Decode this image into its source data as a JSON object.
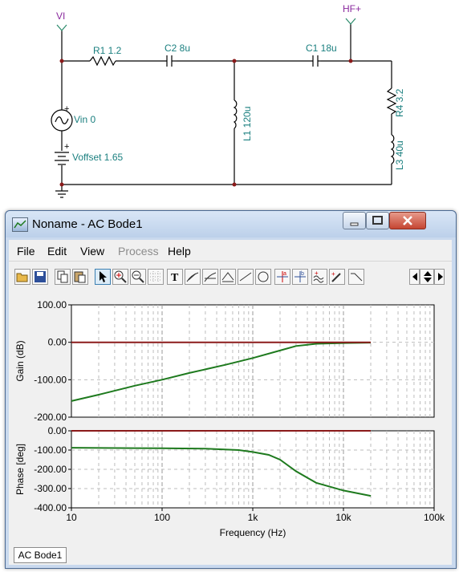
{
  "schematic": {
    "nets": {
      "input": "VI",
      "output": "HF+"
    },
    "components": {
      "R1": "R1 1.2",
      "C2": "C2 8u",
      "C1": "C1 18u",
      "L1": "L1 120u",
      "R4": "R4 3.2",
      "L3": "L3 40u",
      "Vin": "Vin 0",
      "Voffset": "Voffset 1.65"
    }
  },
  "window": {
    "title": "Noname - AC Bode1",
    "menu": [
      "File",
      "Edit",
      "View",
      "Process",
      "Help"
    ],
    "disabled_menu": "Process",
    "tab": "AC Bode1"
  },
  "toolbar_icons": [
    "open-icon",
    "save-icon",
    "copy-icon",
    "paste-icon",
    "pointer-icon",
    "zoom-in-icon",
    "zoom-100-icon",
    "grid-icon",
    "text-icon",
    "tangent-icon",
    "tangent-2-icon",
    "ruler-icon",
    "line-icon",
    "circle-icon",
    "cursor-a-icon",
    "cursor-b-icon",
    "wave-add-icon",
    "probe-icon",
    "step-icon",
    "nav-left-icon",
    "nav-updown-icon",
    "nav-right-icon"
  ],
  "chart_data": [
    {
      "type": "line",
      "ylabel": "Gain (dB)",
      "xscale": "log",
      "xlim": [
        10,
        100000
      ],
      "ylim": [
        -200,
        100
      ],
      "yticks": [
        "100.00",
        "0.00",
        "-100.00",
        "-200.00"
      ],
      "grid": true,
      "series": [
        {
          "color": "#1e7a1e",
          "x": [
            10,
            20,
            50,
            100,
            200,
            500,
            1000,
            2000,
            3000,
            5000,
            10000,
            20000
          ],
          "y": [
            -157,
            -140,
            -116,
            -100,
            -82,
            -60,
            -42,
            -22,
            -10,
            -4,
            -2,
            -1
          ]
        },
        {
          "color": "#8b1a1a",
          "x": [
            10,
            20000
          ],
          "y": [
            0,
            0
          ]
        }
      ]
    },
    {
      "type": "line",
      "ylabel": "Phase [deg]",
      "xlabel": "Frequency (Hz)",
      "xscale": "log",
      "xlim": [
        10,
        100000
      ],
      "ylim": [
        -400,
        0
      ],
      "yticks": [
        "0.00",
        "-100.00",
        "-200.00",
        "-300.00",
        "-400.00"
      ],
      "xticks": [
        "10",
        "100",
        "1k",
        "10k",
        "100k"
      ],
      "grid": true,
      "series": [
        {
          "color": "#1e7a1e",
          "x": [
            10,
            50,
            100,
            300,
            700,
            1000,
            1500,
            2000,
            3000,
            5000,
            10000,
            20000
          ],
          "y": [
            -88,
            -90,
            -91,
            -93,
            -100,
            -110,
            -125,
            -150,
            -210,
            -270,
            -310,
            -338
          ]
        },
        {
          "color": "#8b1a1a",
          "x": [
            10,
            20000
          ],
          "y": [
            0,
            0
          ]
        }
      ]
    }
  ]
}
